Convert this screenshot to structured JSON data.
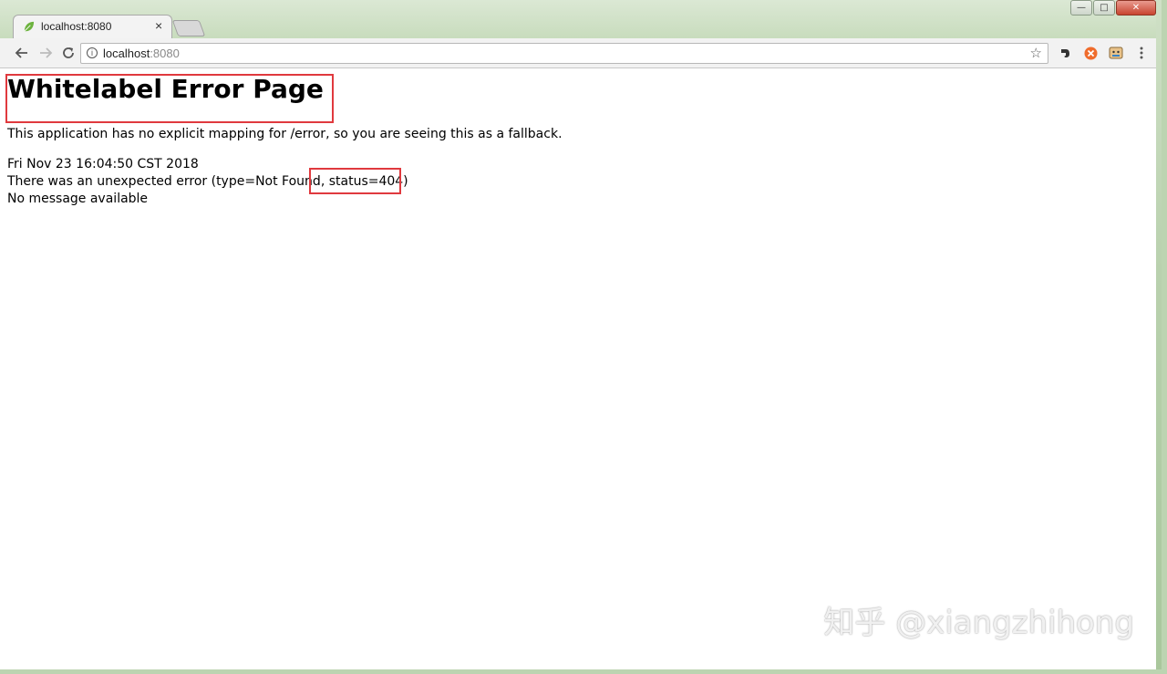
{
  "browser": {
    "tab": {
      "title": "localhost:8080",
      "close": "×"
    },
    "window_controls": {
      "minimize": "—",
      "maximize": "□",
      "close": "✕"
    },
    "address": {
      "host": "localhost",
      "port": ":8080"
    },
    "icons": {
      "back": "back-arrow-icon",
      "forward": "forward-arrow-icon",
      "reload": "reload-icon",
      "info": "info-icon",
      "star": "star-icon",
      "evernote": "evernote-icon",
      "extension_orange": "extension-icon",
      "extension_face": "extension-icon",
      "menu": "kebab-menu-icon"
    }
  },
  "page": {
    "heading": "Whitelabel Error Page",
    "fallback_message": "This application has no explicit mapping for /error, so you are seeing this as a fallback.",
    "timestamp": "Fri Nov 23 16:04:50 CST 2018",
    "error_line_start": "There was an unexpected error (type=Not Found",
    "error_line_status": ", status=404)",
    "no_message": "No message available"
  },
  "watermark": "知乎 @xiangzhihong",
  "colors": {
    "highlight": "#e0393e",
    "favicon": "#6db33f"
  }
}
